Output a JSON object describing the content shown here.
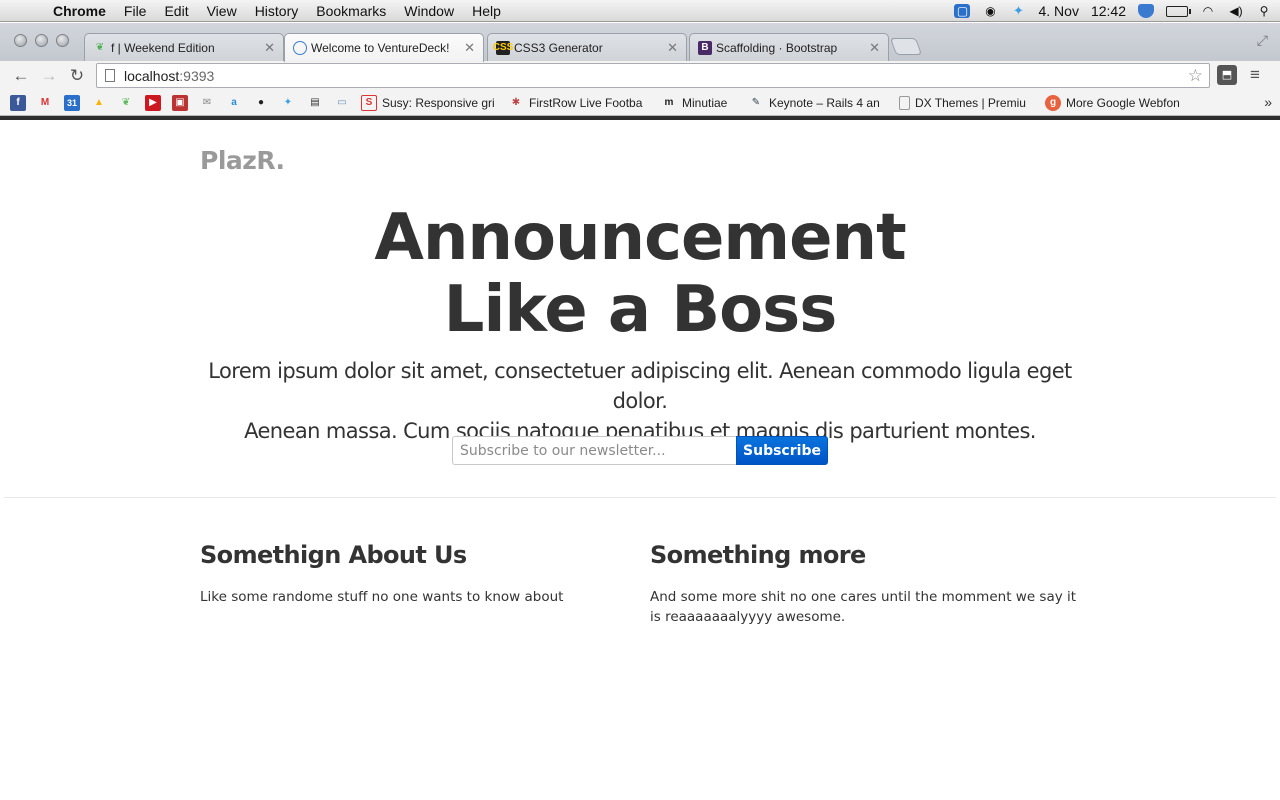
{
  "menubar": {
    "app": "Chrome",
    "items": [
      "File",
      "Edit",
      "View",
      "History",
      "Bookmarks",
      "Window",
      "Help"
    ],
    "date": "4. Nov",
    "time": "12:42"
  },
  "tabs": [
    {
      "title": "f | Weekend Edition",
      "icon": "leaf-icon"
    },
    {
      "title": "Welcome to VentureDeck!",
      "icon": "globe-icon",
      "active": true
    },
    {
      "title": "CSS3 Generator",
      "icon": "css3-icon"
    },
    {
      "title": "Scaffolding · Bootstrap",
      "icon": "bootstrap-icon"
    }
  ],
  "toolbar": {
    "url_host": "localhost",
    "url_port": ":9393"
  },
  "bookmarks": [
    {
      "label": "Susy: Responsive gri",
      "icon": "susy-icon"
    },
    {
      "label": "FirstRow Live Footba",
      "icon": "firstrow-icon"
    },
    {
      "label": "Minutiae",
      "icon": "minutiae-icon"
    },
    {
      "label": "Keynote – Rails 4 an",
      "icon": "keynote-icon"
    },
    {
      "label": "DX Themes | Premiu",
      "icon": "page-icon"
    },
    {
      "label": "More Google Webfon",
      "icon": "google-icon"
    }
  ],
  "page": {
    "brand": "PlazR.",
    "hero_title_line1": "Announcement",
    "hero_title_line2": "Like a Boss",
    "hero_sub_line1": "Lorem ipsum dolor sit amet, consectetuer adipiscing elit. Aenean commodo ligula eget dolor.",
    "hero_sub_line2": "Aenean massa. Cum sociis natoque penatibus et magnis dis parturient montes.",
    "subscribe_placeholder": "Subscribe to our newsletter...",
    "subscribe_button": "Subscribe",
    "features": [
      {
        "heading": "Somethign About Us",
        "text": "Like some randome stuff no one wants to know about"
      },
      {
        "heading": "Something more",
        "text": "And some more shit no one cares until the momment we say it is reaaaaaaalyyyy awesome."
      }
    ]
  },
  "colors": {
    "button_blue": "#0a74de",
    "heading": "#333333",
    "brand_gray": "#9a9a9a"
  }
}
